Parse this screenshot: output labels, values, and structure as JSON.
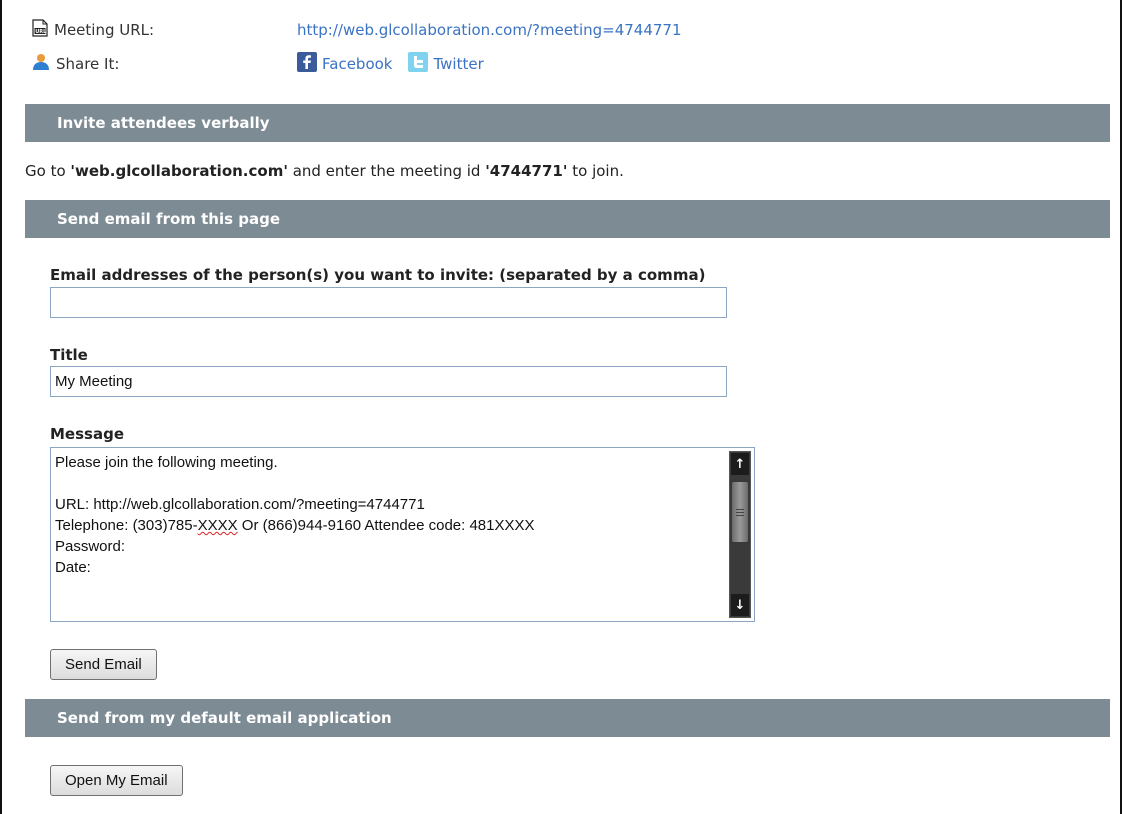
{
  "meeting": {
    "url_label": "Meeting URL:",
    "url_value": "http://web.glcollaboration.com/?meeting=4744771",
    "share_label": "Share It:",
    "facebook_label": "Facebook",
    "twitter_label": "Twitter"
  },
  "sections": {
    "verbal_title": "Invite attendees verbally",
    "email_title": "Send email from this page",
    "default_app_title": "Send from my default email application"
  },
  "verbal": {
    "prefix": "Go to ",
    "site": "'web.glcollaboration.com'",
    "middle": " and enter the meeting id ",
    "meeting_id": "'4744771'",
    "suffix": " to join."
  },
  "email_form": {
    "addresses_label": "Email addresses of the person(s) you want to invite: (separated by a comma)",
    "addresses_value": "",
    "title_label": "Title",
    "title_value": "My Meeting",
    "message_label": "Message",
    "message_lines": [
      "Please join the following meeting.",
      "",
      "URL: http://web.glcollaboration.com/?meeting=4744771",
      "Telephone: (303)785-XXXX Or (866)944-9160 Attendee code: 481XXXX",
      "Password:",
      "Date:"
    ],
    "send_button": "Send Email"
  },
  "default_app": {
    "open_button": "Open My Email"
  },
  "colors": {
    "section_bar": "#7d8b94",
    "link": "#3b73c4"
  }
}
